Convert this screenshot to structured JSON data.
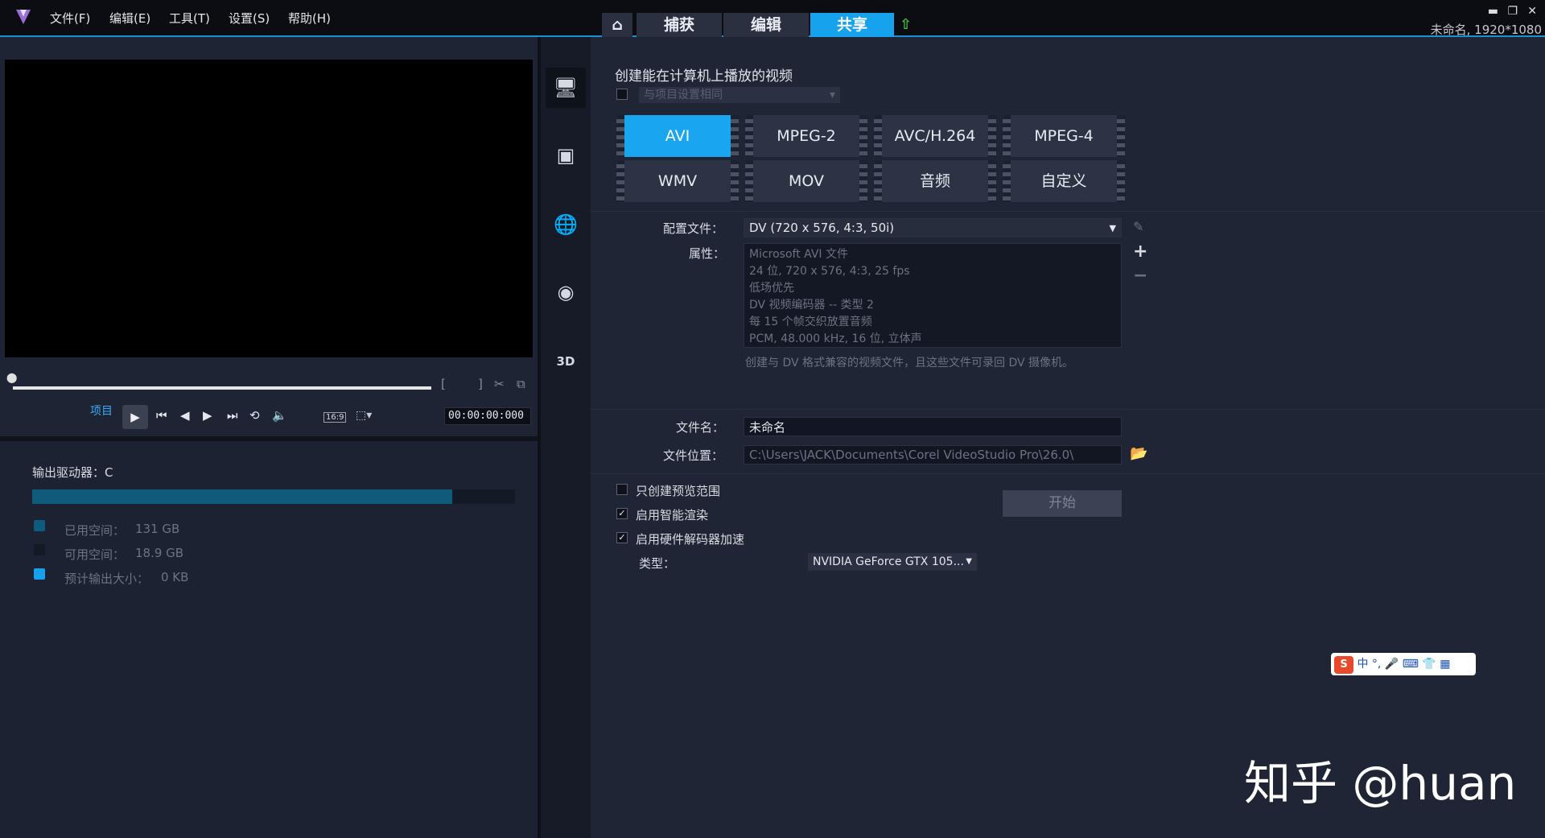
{
  "menu": {
    "file": "文件(F)",
    "edit": "编辑(E)",
    "tools": "工具(T)",
    "settings": "设置(S)",
    "help": "帮助(H)"
  },
  "nav": {
    "capture": "捕获",
    "edit": "编辑",
    "share": "共享"
  },
  "project_info": "未命名, 1920*1080",
  "player": {
    "mode_label": "项目",
    "aspect": "16:9",
    "timecode": "00:00:00:000"
  },
  "drive": {
    "title": "输出驱动器：C",
    "used_fraction": 0.87,
    "used_label": "已用空间：",
    "used_value": "131 GB",
    "free_label": "可用空间：",
    "free_value": "18.9 GB",
    "est_label": "预计输出大小：",
    "est_value": "0 KB",
    "colors": {
      "used": "#0e5b7c",
      "free": "#141926",
      "est": "#16a0ee"
    }
  },
  "share": {
    "heading": "创建能在计算机上播放的视频",
    "same_as_project": "与项目设置相同",
    "formats": [
      "AVI",
      "MPEG-2",
      "AVC/H.264",
      "MPEG-4",
      "WMV",
      "MOV",
      "音频",
      "自定义"
    ],
    "profile_label": "配置文件：",
    "profile_value": "DV (720 x 576, 4:3, 50i)",
    "properties_label": "属性：",
    "properties": [
      "Microsoft AVI 文件",
      "24 位, 720 x 576, 4:3, 25 fps",
      "低场优先",
      "DV 视频编码器 -- 类型 2",
      "每 15 个帧交织放置音频",
      "PCM, 48.000 kHz, 16 位, 立体声"
    ],
    "description": "创建与 DV 格式兼容的视频文件，且这些文件可录回 DV 摄像机。",
    "filename_label": "文件名：",
    "filename_value": "未命名",
    "location_label": "文件位置：",
    "location_value": "C:\\Users\\JACK\\Documents\\Corel VideoStudio Pro\\26.0\\",
    "preview_only": "只创建预览范围",
    "smart_render": "启用智能渲染",
    "hw_accel": "启用硬件解码器加速",
    "type_label": "类型：",
    "type_value": "NVIDIA GeForce GTX 105...",
    "start_button": "开始"
  },
  "ime": {
    "text": "中"
  },
  "watermark": "知乎 @huan"
}
